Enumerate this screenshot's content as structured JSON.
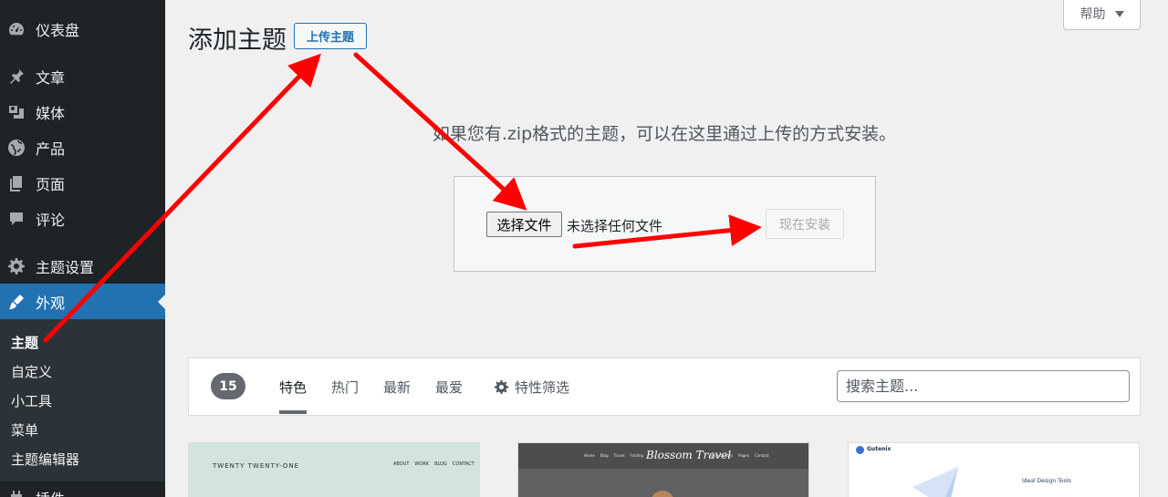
{
  "sidebar": {
    "items": [
      {
        "label": "仪表盘",
        "icon": "dashboard-icon"
      },
      {
        "label": "文章",
        "icon": "pin-icon"
      },
      {
        "label": "媒体",
        "icon": "media-icon"
      },
      {
        "label": "产品",
        "icon": "globe-icon"
      },
      {
        "label": "页面",
        "icon": "page-icon"
      },
      {
        "label": "评论",
        "icon": "comment-icon"
      },
      {
        "label": "主题设置",
        "icon": "gear-icon"
      },
      {
        "label": "外观",
        "icon": "brush-icon",
        "active": true
      },
      {
        "label": "插件",
        "icon": "plugin-icon"
      }
    ],
    "submenu": [
      "主题",
      "自定义",
      "小工具",
      "菜单",
      "主题编辑器"
    ],
    "submenu_current": "主题"
  },
  "header": {
    "title": "添加主题",
    "upload_button": "上传主题",
    "help_button": "帮助"
  },
  "upload": {
    "description": "如果您有.zip格式的主题，可以在这里通过上传的方式安装。",
    "choose_file": "选择文件",
    "file_status": "未选择任何文件",
    "install_button": "现在安装"
  },
  "filter": {
    "count": "15",
    "tabs": [
      "特色",
      "热门",
      "最新",
      "最爱"
    ],
    "current_tab": "特色",
    "feature_filter": "特性筛选",
    "search_placeholder": "搜索主题..."
  },
  "themes": [
    {
      "name": "TWENTY TWENTY-ONE",
      "nav": [
        "ABOUT",
        "WORK",
        "BLOG",
        "CONTACT"
      ]
    },
    {
      "name": "Blossom Travel",
      "nav": [
        "Home",
        "Blog",
        "Travel",
        "Folding"
      ],
      "nav_right": [
        "Style Guides",
        "Pages",
        "Contact"
      ]
    },
    {
      "name": "Gutenix",
      "headline": "Ideal Design Tools"
    }
  ],
  "colors": {
    "sidebar_bg": "#1d2327",
    "submenu_bg": "#2c3338",
    "accent": "#2271b1",
    "page_bg": "#f0f0f1",
    "annotation_arrow": "#ff0000"
  }
}
